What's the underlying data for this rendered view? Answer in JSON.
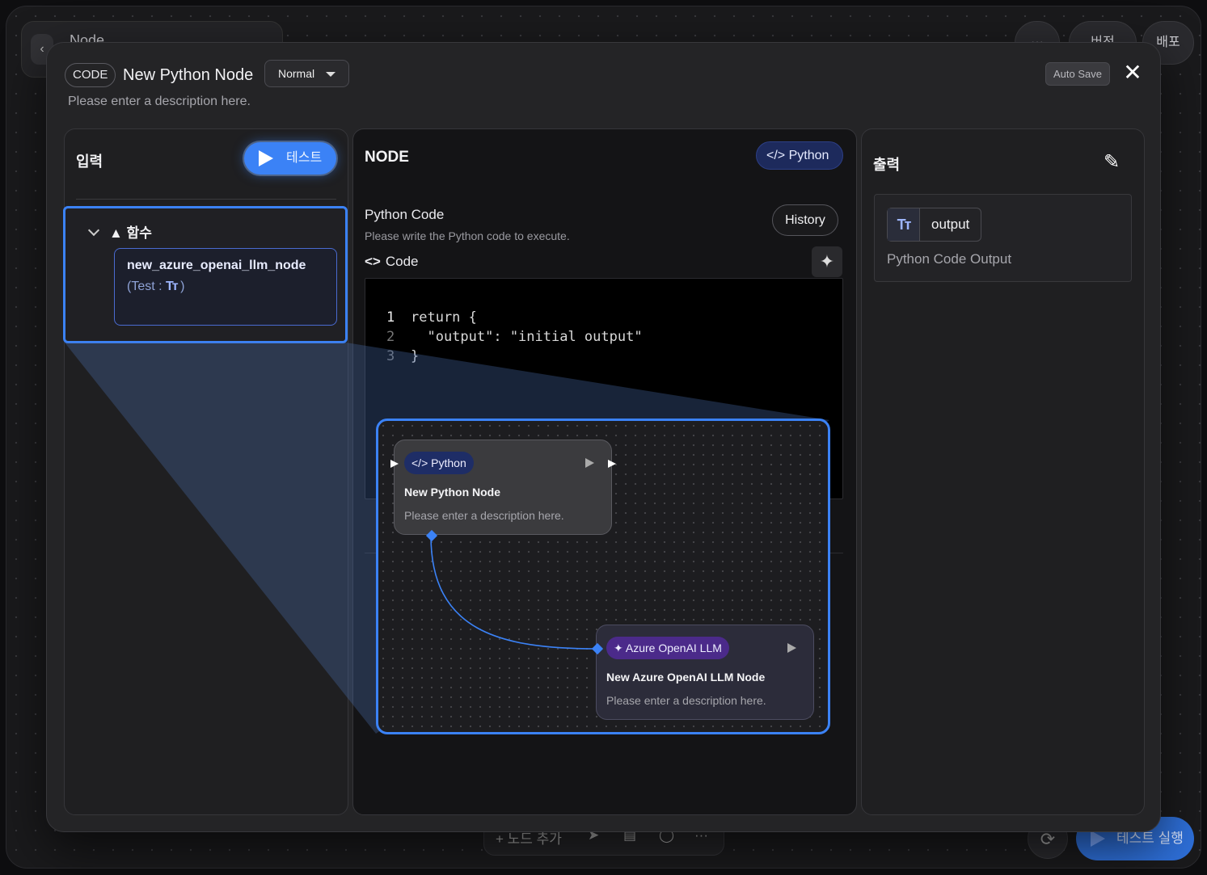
{
  "background": {
    "title": "Node",
    "more_label": "···",
    "version_label": "버전",
    "deploy_label": "배포",
    "add_node_label": "+ 노드 추가",
    "more_bottom_label": "···",
    "run_test_label": "테스트 실행"
  },
  "modal": {
    "type_chip": "CODE",
    "title": "New Python Node",
    "mode": "Normal",
    "description": "Please enter a description here.",
    "autosave_label": "Auto Save"
  },
  "input_panel": {
    "title": "입력",
    "test_button": "테스트",
    "group_label": "함수",
    "function": {
      "name": "new_azure_openai_llm_node",
      "test_prefix": "(Test :",
      "type_icon_text": "Tт",
      "test_suffix": ")"
    }
  },
  "node_panel": {
    "title": "NODE",
    "language_chip": "Python",
    "code_title": "Python Code",
    "code_subtitle": "Please write the Python code to execute.",
    "history_button": "History",
    "code_label": "Code",
    "code_lines": [
      {
        "num": "1",
        "text": "return {"
      },
      {
        "num": "2",
        "text": "  \"output\": \"initial output\""
      },
      {
        "num": "3",
        "text": "}"
      }
    ]
  },
  "output_panel": {
    "title": "출력",
    "type_icon_text": "Tт",
    "output_name": "output",
    "output_description": "Python Code Output"
  },
  "zoom_preview": {
    "python_node": {
      "chip": "Python",
      "title": "New Python Node",
      "description": "Please enter a description here."
    },
    "azure_node": {
      "chip": "Azure OpenAI LLM",
      "title": "New Azure OpenAI LLM Node",
      "description": "Please enter a description here."
    },
    "colors": {
      "accent": "#3b82f6",
      "python_chip": "#1e2d66",
      "azure_chip": "#4b2a8a"
    }
  }
}
